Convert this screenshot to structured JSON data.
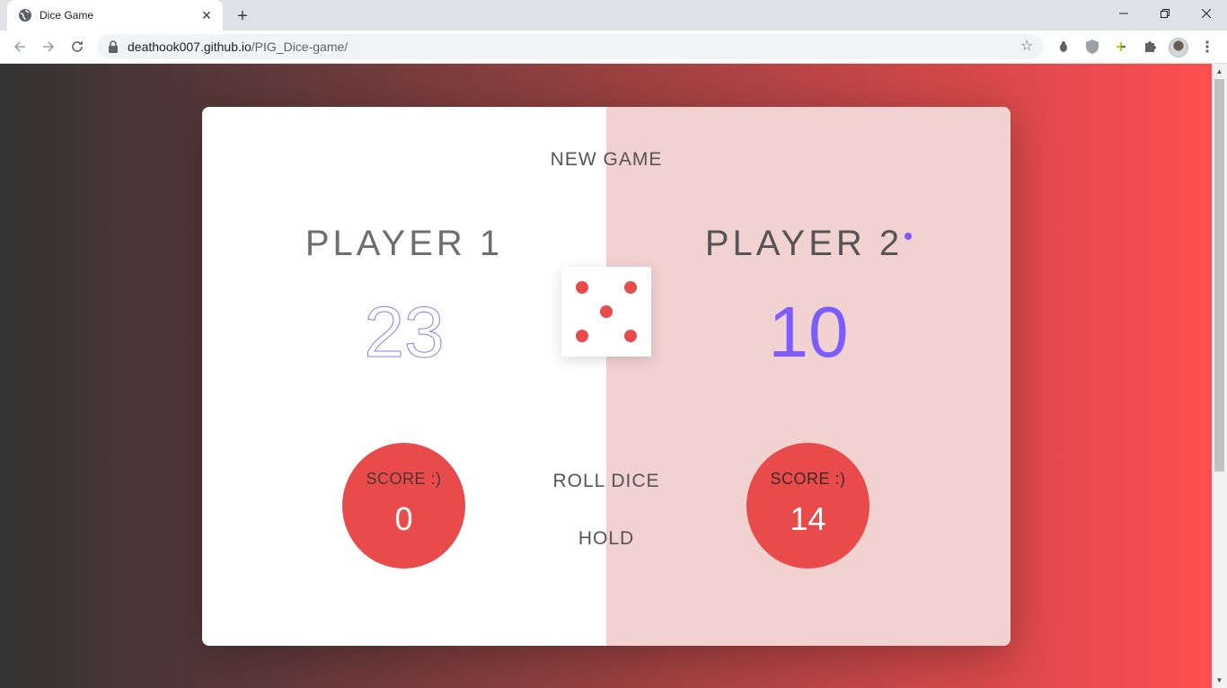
{
  "browser": {
    "tab_title": "Dice Game",
    "url_host": "deathook007.github.io",
    "url_path": "/PIG_Dice-game/"
  },
  "game": {
    "new_game": "NEW GAME",
    "roll_dice": "ROLL DICE",
    "hold": "HOLD",
    "active_player": 2,
    "dice_value": 5,
    "players": [
      {
        "name": "PLAYER 1",
        "score": "23",
        "current_label": "SCORE :)",
        "current": "0"
      },
      {
        "name": "PLAYER 2",
        "score": "10",
        "current_label": "SCORE :)",
        "current": "14"
      }
    ]
  },
  "colors": {
    "bg_gradient_start": "#333333",
    "bg_gradient_end": "#ff4e50",
    "accent_score": "#7b5cff",
    "current_circle": "#e94b4b",
    "active_panel": "#f2d1d1"
  }
}
